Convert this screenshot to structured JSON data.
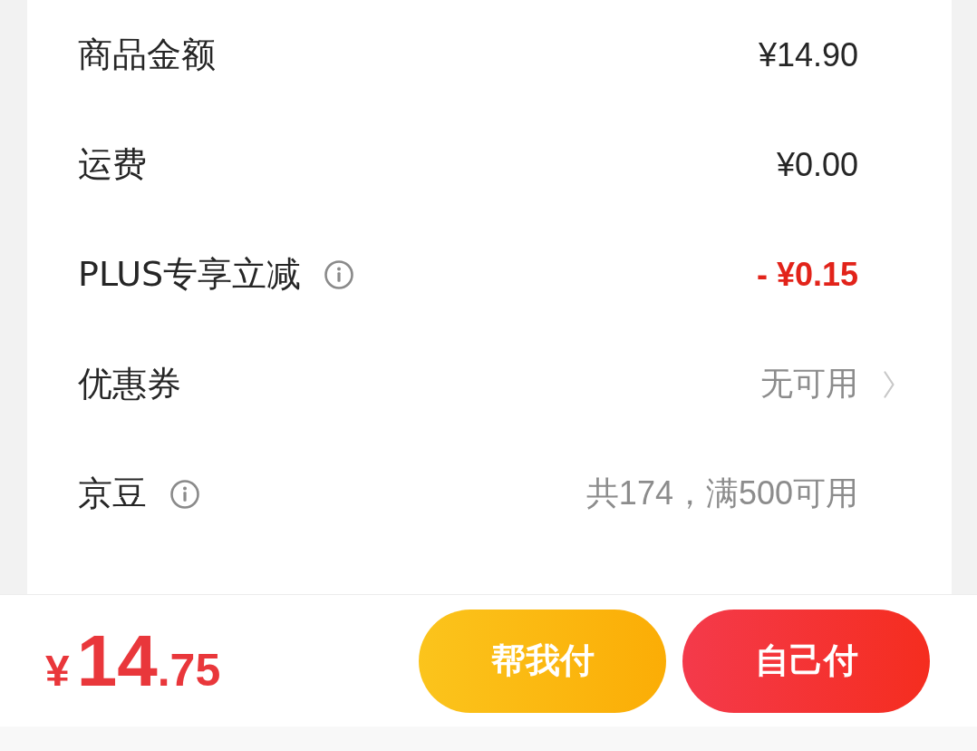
{
  "summary_rows": [
    {
      "kind": "amount",
      "label": "商品金额",
      "info": false,
      "value": "¥14.90"
    },
    {
      "kind": "amount",
      "label": "运费",
      "info": false,
      "value": "¥0.00"
    },
    {
      "kind": "discount",
      "label": "PLUS专享立减",
      "info": true,
      "value": "- ¥0.15"
    },
    {
      "kind": "link",
      "label": "优惠券",
      "info": false,
      "value": "无可用"
    },
    {
      "kind": "note",
      "label": "京豆",
      "info": true,
      "value": "共174，满500可用"
    }
  ],
  "checkout_bar": {
    "total": {
      "currency": "¥",
      "whole": "14",
      "fraction": ".75"
    },
    "buttons": [
      {
        "kind": "secondary",
        "label": "帮我付"
      },
      {
        "kind": "primary",
        "label": "自己付"
      }
    ]
  }
}
